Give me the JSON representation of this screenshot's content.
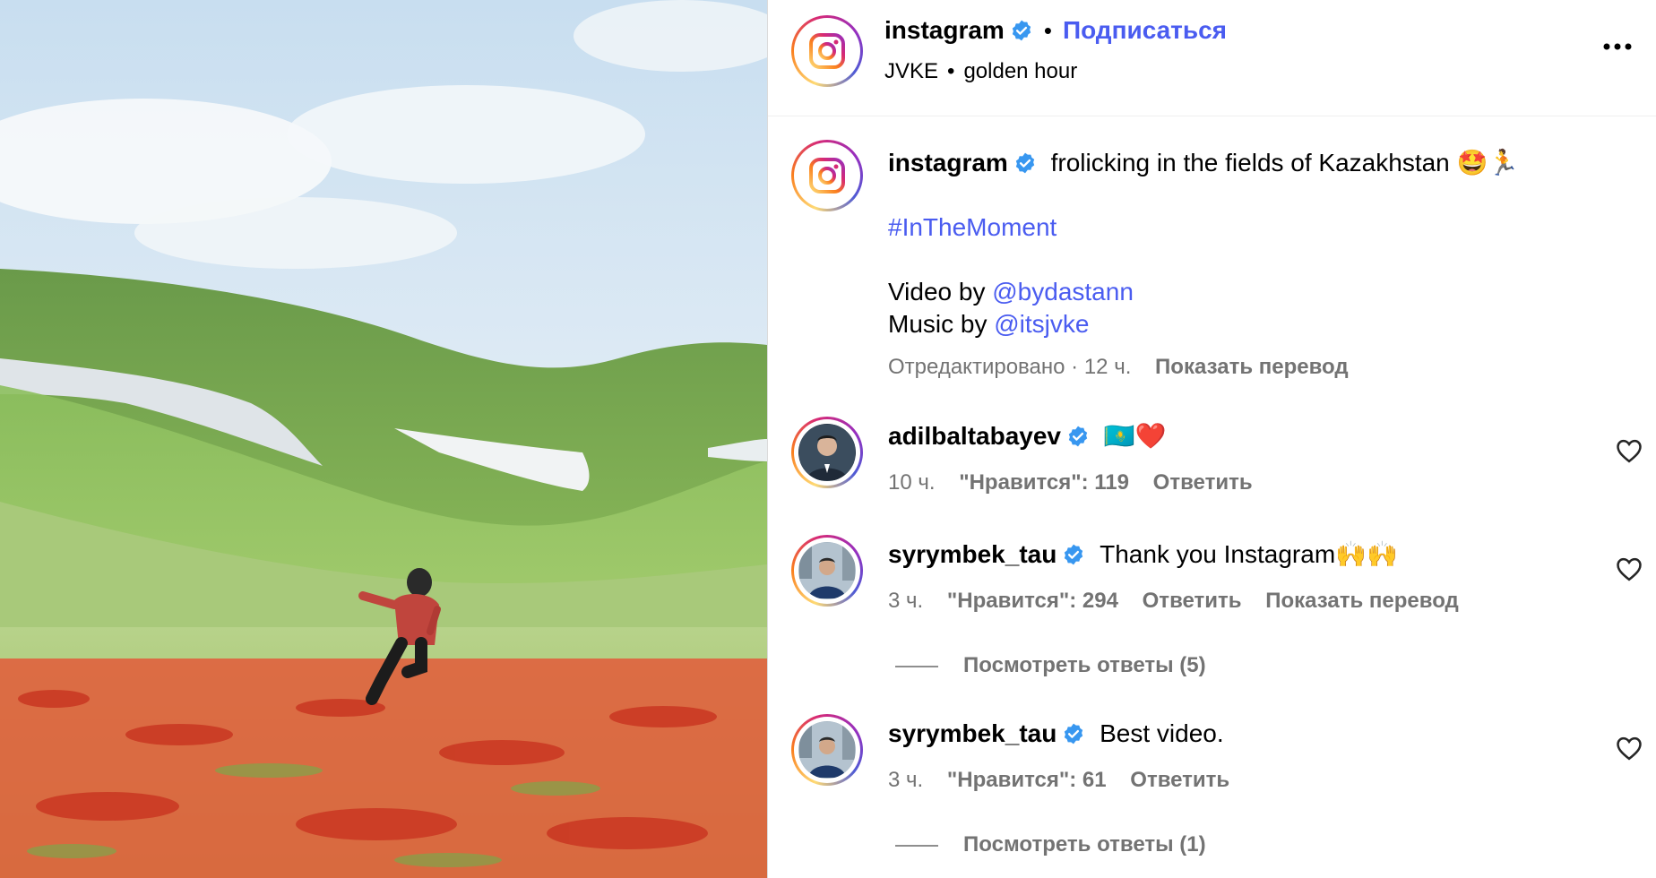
{
  "header": {
    "username": "instagram",
    "dot": "•",
    "follow_label": "Подписаться",
    "audio_artist": "JVKE",
    "audio_dot": "•",
    "audio_track": "golden hour"
  },
  "caption": {
    "username": "instagram",
    "text": "frolicking in the fields of Kazakhstan 🤩🏃",
    "hashtag": "#InTheMoment",
    "video_by_label": "Video by ",
    "video_by_handle": "@bydastann",
    "music_by_label": "Music by ",
    "music_by_handle": "@itsjvke",
    "edited_label": "Отредактировано",
    "dot": "·",
    "time": "12 ч.",
    "translate_label": "Показать перевод"
  },
  "comments": [
    {
      "username": "adilbaltabayev",
      "text": "🇰🇿❤️",
      "time": "10 ч.",
      "likes_label": "\"Нравится\": 119",
      "reply_label": "Ответить"
    },
    {
      "username": "syrymbek_tau",
      "text": "Thank you Instagram🙌🙌",
      "time": "3 ч.",
      "likes_label": "\"Нравится\": 294",
      "reply_label": "Ответить",
      "translate_label": "Показать перевод",
      "view_replies_label": "Посмотреть ответы (5)"
    },
    {
      "username": "syrymbek_tau",
      "text": "Best video.",
      "time": "3 ч.",
      "likes_label": "\"Нравится\": 61",
      "reply_label": "Ответить",
      "view_replies_label": "Посмотреть ответы (1)"
    }
  ],
  "colors": {
    "link": "#4a5cf0",
    "muted": "#737373",
    "verified": "#3897f0"
  },
  "icons": {
    "more": "more-options-icon",
    "verified": "verified-badge-icon",
    "heart": "heart-outline-icon",
    "logo": "instagram-logo-icon"
  }
}
